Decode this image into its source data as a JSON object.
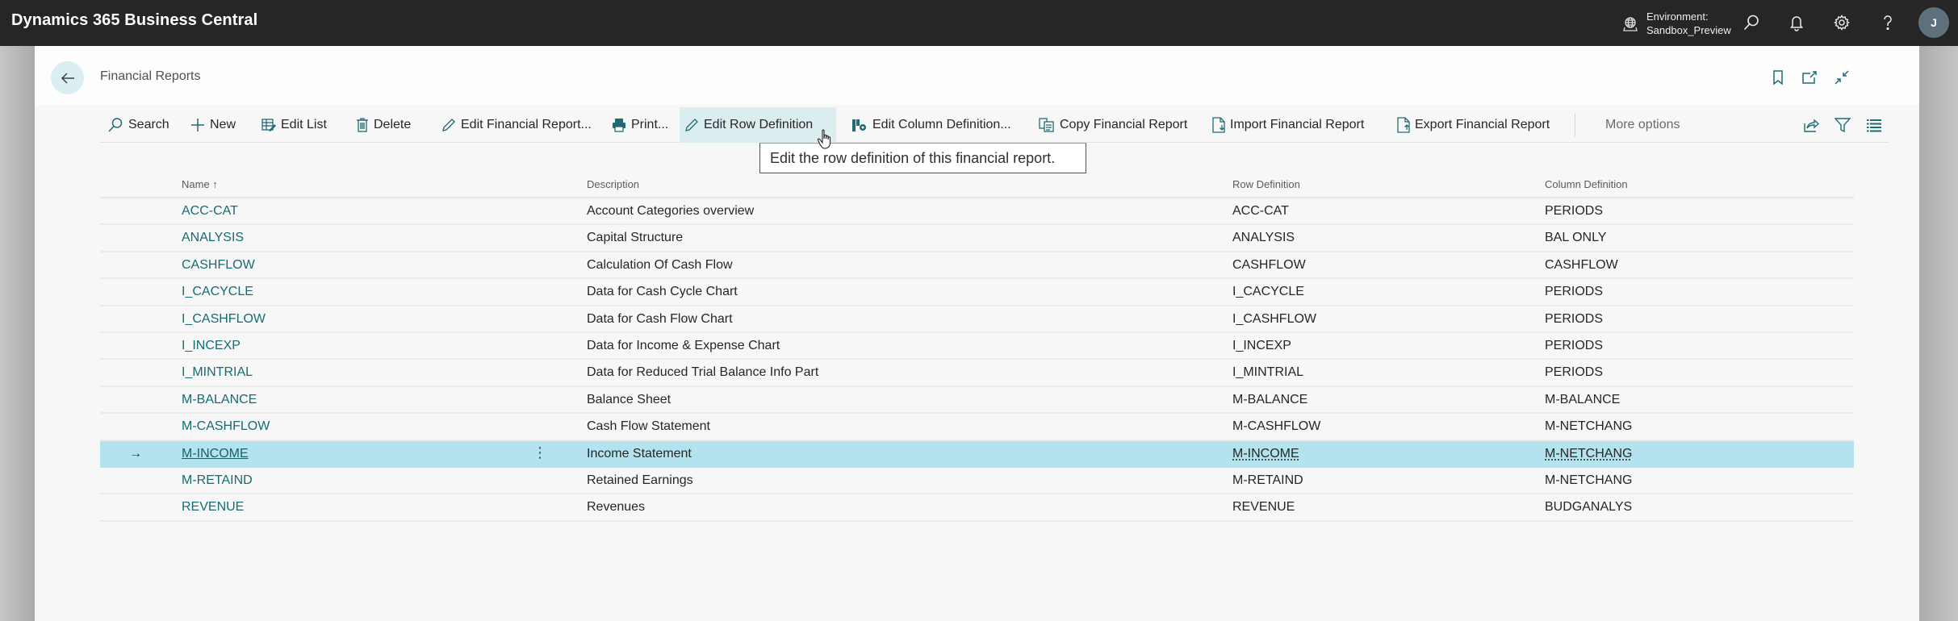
{
  "app": {
    "title": "Dynamics 365 Business Central",
    "environment_label": "Environment:",
    "environment_value": "Sandbox_Preview",
    "avatar_initial": "J"
  },
  "page": {
    "title": "Financial Reports"
  },
  "toolbar": {
    "search": "Search",
    "new": "New",
    "edit_list": "Edit List",
    "delete": "Delete",
    "edit_financial_report": "Edit Financial Report...",
    "print": "Print...",
    "edit_row_definition": "Edit Row Definition",
    "edit_column_definition": "Edit Column Definition...",
    "copy_financial_report": "Copy Financial Report",
    "import_financial_report": "Import Financial Report",
    "export_financial_report": "Export Financial Report",
    "more_options": "More options"
  },
  "tooltip": {
    "text": "Edit the row definition of this financial report."
  },
  "table": {
    "columns": {
      "name": "Name ↑",
      "description": "Description",
      "row_definition": "Row Definition",
      "column_definition": "Column Definition"
    },
    "rows": [
      {
        "name": "ACC-CAT",
        "description": "Account Categories overview",
        "row_def": "ACC-CAT",
        "col_def": "PERIODS"
      },
      {
        "name": "ANALYSIS",
        "description": "Capital Structure",
        "row_def": "ANALYSIS",
        "col_def": "BAL ONLY"
      },
      {
        "name": "CASHFLOW",
        "description": "Calculation Of Cash Flow",
        "row_def": "CASHFLOW",
        "col_def": "CASHFLOW"
      },
      {
        "name": "I_CACYCLE",
        "description": "Data for Cash Cycle Chart",
        "row_def": "I_CACYCLE",
        "col_def": "PERIODS"
      },
      {
        "name": "I_CASHFLOW",
        "description": "Data for Cash Flow Chart",
        "row_def": "I_CASHFLOW",
        "col_def": "PERIODS"
      },
      {
        "name": "I_INCEXP",
        "description": "Data for Income & Expense Chart",
        "row_def": "I_INCEXP",
        "col_def": "PERIODS"
      },
      {
        "name": "I_MINTRIAL",
        "description": "Data for Reduced Trial Balance Info Part",
        "row_def": "I_MINTRIAL",
        "col_def": "PERIODS"
      },
      {
        "name": "M-BALANCE",
        "description": "Balance Sheet",
        "row_def": "M-BALANCE",
        "col_def": "M-BALANCE"
      },
      {
        "name": "M-CASHFLOW",
        "description": "Cash Flow Statement",
        "row_def": "M-CASHFLOW",
        "col_def": "M-NETCHANG"
      },
      {
        "name": "M-INCOME",
        "description": "Income Statement",
        "row_def": "M-INCOME",
        "col_def": "M-NETCHANG",
        "selected": true
      },
      {
        "name": "M-RETAIND",
        "description": "Retained Earnings",
        "row_def": "M-RETAIND",
        "col_def": "M-NETCHANG"
      },
      {
        "name": "REVENUE",
        "description": "Revenues",
        "row_def": "REVENUE",
        "col_def": "BUDGANALYS"
      }
    ],
    "selected_row_indicator": "→",
    "row_actions_glyph": "⋮"
  },
  "colors": {
    "topbar": "#262626",
    "accent": "#166c72",
    "selected_row": "#b2e3ee",
    "active_action": "#dcedf0"
  }
}
